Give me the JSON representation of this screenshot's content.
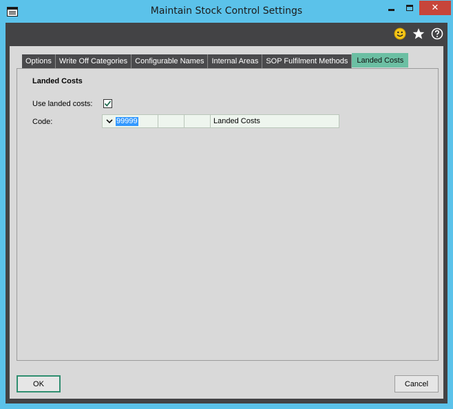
{
  "window": {
    "title": "Maintain Stock Control Settings",
    "icon": "form-window-icon",
    "controls": {
      "minimize": "minimize-icon",
      "maximize": "maximize-icon",
      "close": "✕"
    }
  },
  "toolbar_icons": [
    "smiley-icon",
    "star-icon",
    "help-icon"
  ],
  "tabs": [
    {
      "label": "Options"
    },
    {
      "label": "Write Off Categories"
    },
    {
      "label": "Configurable Names"
    },
    {
      "label": "Internal Areas"
    },
    {
      "label": "SOP Fulfilment Methods"
    },
    {
      "label": "Landed Costs",
      "active": true
    }
  ],
  "landed_costs": {
    "section_title": "Landed Costs",
    "use_landed_costs_label": "Use landed costs:",
    "use_landed_costs_checked": true,
    "code_label": "Code:",
    "code_value": "99999",
    "code_name": "Landed Costs"
  },
  "buttons": {
    "ok": "OK",
    "cancel": "Cancel"
  },
  "colors": {
    "titlebar": "#5bc2ea",
    "active_tab": "#6cbfa3",
    "close_button": "#c7453a",
    "ok_border": "#2f8e70"
  }
}
